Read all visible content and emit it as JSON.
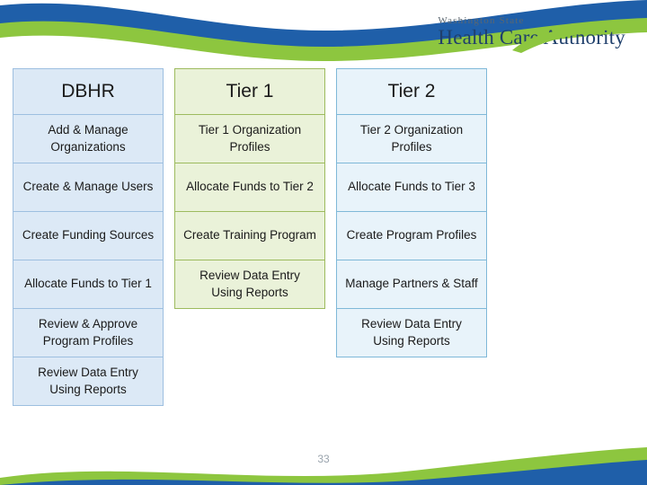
{
  "logo": {
    "line1": "Washington State",
    "line2": "Health Care Authority"
  },
  "table": {
    "columns": [
      {
        "key": "dbhr",
        "header": "DBHR",
        "cells": [
          "Add & Manage Organizations",
          "Create & Manage Users",
          "Create Funding Sources",
          "Allocate Funds to Tier 1",
          "Review & Approve Program Profiles",
          "Review Data Entry Using Reports"
        ]
      },
      {
        "key": "tier1",
        "header": "Tier 1",
        "cells": [
          "Tier 1 Organization Profiles",
          "Allocate Funds to Tier 2",
          "Create Training Program",
          "Review Data Entry Using Reports"
        ]
      },
      {
        "key": "tier2",
        "header": "Tier 2",
        "cells": [
          "Tier 2 Organization Profiles",
          "Allocate Funds to Tier 3",
          "Create Program Profiles",
          "Manage Partners & Staff",
          "Review Data Entry Using Reports"
        ]
      }
    ]
  },
  "footer": {
    "page_number": "33"
  },
  "colors": {
    "dbhr_fill": "#dce9f6",
    "dbhr_border": "#9dbfe0",
    "tier1_fill": "#eaf2d9",
    "tier1_border": "#9dbb5e",
    "tier2_fill": "#e8f3fa",
    "tier2_border": "#7fb8d8",
    "brand_blue": "#1f5fa9",
    "brand_green": "#8dc63f"
  }
}
